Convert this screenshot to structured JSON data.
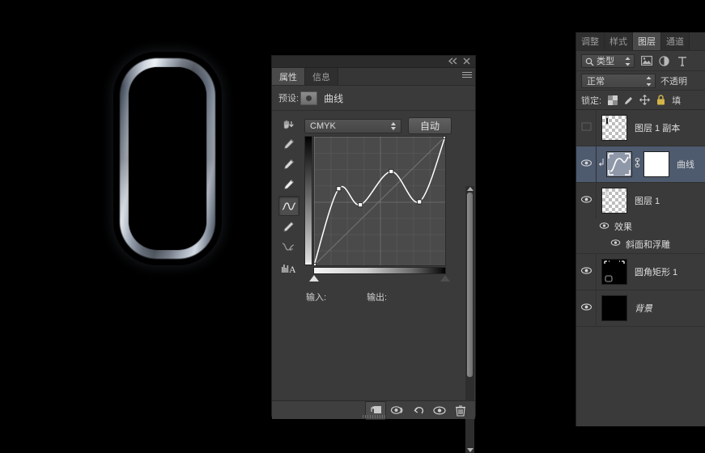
{
  "app": {
    "background_color": "#000000",
    "panel_bg": "#3a3a3a"
  },
  "canvas": {
    "artwork_name": "rounded-rectangle-metal-frame"
  },
  "properties_panel": {
    "titlebar": {
      "collapse_icon": "double-left-arrow",
      "close_icon": "close-x"
    },
    "tabs": [
      {
        "label": "属性",
        "active": true
      },
      {
        "label": "信息",
        "active": false
      }
    ],
    "menu_icon": "panel-menu-icon",
    "preset_label": "预设:",
    "adjustment_title": "曲线",
    "channel_value": "CMYK",
    "auto_button": "自动",
    "tools": [
      {
        "name": "on-image-adjust-icon",
        "active": false
      },
      {
        "name": "eyedropper-black-point-icon",
        "active": false
      },
      {
        "name": "eyedropper-gray-point-icon",
        "active": false
      },
      {
        "name": "eyedropper-white-point-icon",
        "active": false
      },
      {
        "name": "curve-point-edit-icon",
        "active": true
      },
      {
        "name": "pencil-draw-curve-icon",
        "active": false
      },
      {
        "name": "smooth-curve-icon",
        "active": false
      },
      {
        "name": "histogram-warning-icon",
        "active": false
      }
    ],
    "input_label": "输入:",
    "output_label": "输出:",
    "input_value": "",
    "output_value": "",
    "footer_buttons": [
      {
        "name": "clip-to-layer-icon",
        "pressed": true
      },
      {
        "name": "view-previous-state-icon",
        "pressed": false
      },
      {
        "name": "reset-adjustment-icon",
        "pressed": false
      },
      {
        "name": "toggle-visibility-icon",
        "pressed": false
      },
      {
        "name": "delete-adjustment-icon",
        "pressed": false
      }
    ]
  },
  "chart_data": {
    "type": "line",
    "title": "曲线",
    "xlabel": "输入",
    "ylabel": "输出",
    "xlim": [
      0,
      255
    ],
    "ylim": [
      0,
      255
    ],
    "grid": true,
    "legend": "none",
    "channel": "CMYK",
    "series": [
      {
        "name": "curve",
        "points": [
          {
            "input": 0,
            "output": 0
          },
          {
            "input": 48,
            "output": 152
          },
          {
            "input": 90,
            "output": 120
          },
          {
            "input": 150,
            "output": 186
          },
          {
            "input": 205,
            "output": 126
          },
          {
            "input": 255,
            "output": 255
          }
        ]
      },
      {
        "name": "baseline-diagonal",
        "points": [
          {
            "input": 0,
            "output": 0
          },
          {
            "input": 255,
            "output": 255
          }
        ]
      }
    ]
  },
  "layers_panel": {
    "tabs": [
      {
        "label": "调整",
        "active": false
      },
      {
        "label": "样式",
        "active": false
      },
      {
        "label": "图层",
        "active": true
      },
      {
        "label": "通道",
        "active": false
      }
    ],
    "filter": {
      "search_icon": "search-icon",
      "kind_value": "类型",
      "icons": [
        {
          "name": "filter-pixel-layers-icon"
        },
        {
          "name": "filter-adjustment-layers-icon"
        },
        {
          "name": "filter-type-layers-icon"
        }
      ]
    },
    "blend_mode": "正常",
    "opacity_label": "不透明",
    "lock_label": "锁定:",
    "lock_icons": [
      {
        "name": "lock-transparent-pixels-icon"
      },
      {
        "name": "lock-image-pixels-icon"
      },
      {
        "name": "lock-position-icon"
      },
      {
        "name": "lock-all-icon"
      }
    ],
    "fill_label": "填",
    "layers": [
      {
        "name": "图层 1 副本",
        "visible": false,
        "selected": false,
        "thumb": "checker",
        "italic": false,
        "type": "pixel"
      },
      {
        "name": "曲线",
        "visible": true,
        "selected": true,
        "thumb": "adjustment",
        "italic": false,
        "type": "adjustment",
        "has_mask": true,
        "clipped": true
      },
      {
        "name": "图层 1",
        "visible": true,
        "selected": false,
        "thumb": "checker",
        "italic": false,
        "type": "pixel",
        "effects": [
          {
            "name": "效果",
            "indent": 0
          },
          {
            "name": "斜面和浮雕",
            "indent": 1
          }
        ]
      },
      {
        "name": "圆角矩形 1",
        "visible": true,
        "selected": false,
        "thumb": "black-vector",
        "italic": false,
        "type": "shape"
      },
      {
        "name": "背景",
        "visible": true,
        "selected": false,
        "thumb": "black",
        "italic": true,
        "type": "background"
      }
    ]
  }
}
